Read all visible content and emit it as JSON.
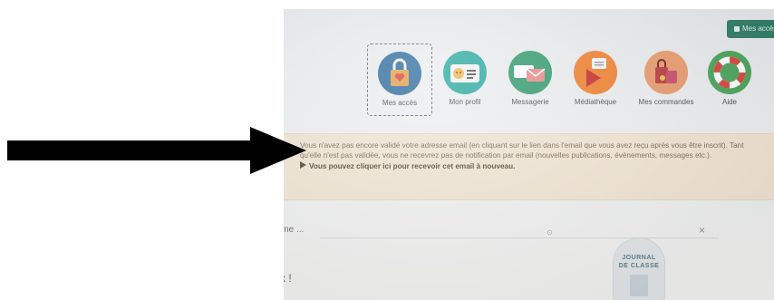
{
  "header": {
    "access_button": "Mes accès"
  },
  "menu": [
    {
      "label": "Mes accès",
      "icon": "padlock-heart-icon",
      "selected": true
    },
    {
      "label": "Mon profil",
      "icon": "profile-card-icon"
    },
    {
      "label": "Messagerie",
      "icon": "envelope-chat-icon"
    },
    {
      "label": "Médiathèque",
      "icon": "media-library-icon"
    },
    {
      "label": "Mes commandes",
      "icon": "shopping-bags-icon"
    },
    {
      "label": "Aide",
      "icon": "lifebuoy-icon"
    }
  ],
  "notice": {
    "text": "Vous n'avez pas encore validé votre adresse email (en cliquant sur le lien dans l'email que vous avez reçu après vous être inscrit). Tant qu'elle n'est pas validée, vous ne recevrez pas de notification par email (nouvelles publications, évènements, messages etc.).",
    "cta": "Vous pouvez cliquer ici pour recevoir cet email à nouveau."
  },
  "form": {
    "label": "rme ...",
    "close": "×"
  },
  "journal": {
    "line1": "JOURNAL",
    "line2": "DE CLASSE"
  },
  "heading": "x !",
  "colors": {
    "accent": "#2d7c64",
    "notice_bg": "#f2e6d4",
    "arrow": "#000000"
  }
}
